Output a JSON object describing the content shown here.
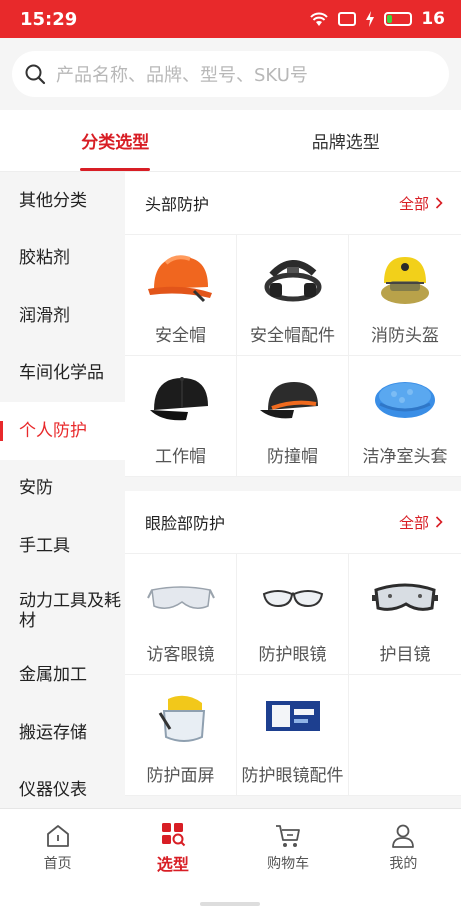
{
  "status": {
    "time": "15:29",
    "battery": "16",
    "battery_color": "#3ed640"
  },
  "search": {
    "placeholder": "产品名称、品牌、型号、SKU号"
  },
  "tabs": [
    {
      "label": "分类选型",
      "active": true
    },
    {
      "label": "品牌选型",
      "active": false
    }
  ],
  "sidebar": {
    "items": [
      {
        "label": "其他分类"
      },
      {
        "label": "胶粘剂"
      },
      {
        "label": "润滑剂"
      },
      {
        "label": "车间化学品"
      },
      {
        "label": "个人防护",
        "active": true
      },
      {
        "label": "安防"
      },
      {
        "label": "手工具"
      },
      {
        "label": "动力工具及耗材"
      },
      {
        "label": "金属加工"
      },
      {
        "label": "搬运存储"
      },
      {
        "label": "仪器仪表"
      }
    ]
  },
  "sections": [
    {
      "title": "头部防护",
      "all_label": "全部",
      "items": [
        {
          "label": "安全帽",
          "icon": "hard-hat-orange"
        },
        {
          "label": "安全帽配件",
          "icon": "hat-suspension"
        },
        {
          "label": "消防头盔",
          "icon": "fire-helmet"
        },
        {
          "label": "工作帽",
          "icon": "work-cap"
        },
        {
          "label": "防撞帽",
          "icon": "bump-cap"
        },
        {
          "label": "洁净室头套",
          "icon": "cleanroom-cap"
        }
      ]
    },
    {
      "title": "眼脸部防护",
      "all_label": "全部",
      "items": [
        {
          "label": "访客眼镜",
          "icon": "visitor-glasses"
        },
        {
          "label": "防护眼镜",
          "icon": "safety-glasses"
        },
        {
          "label": "护目镜",
          "icon": "goggles"
        },
        {
          "label": "防护面屏",
          "icon": "face-shield"
        },
        {
          "label": "防护眼镜配件",
          "icon": "glasses-accessory"
        }
      ]
    }
  ],
  "bottom_nav": [
    {
      "label": "首页",
      "icon": "home-icon"
    },
    {
      "label": "选型",
      "icon": "category-search-icon",
      "active": true
    },
    {
      "label": "购物车",
      "icon": "cart-icon"
    },
    {
      "label": "我的",
      "icon": "user-icon"
    }
  ],
  "colors": {
    "brand": "#e8292b",
    "accent": "#d81e25"
  }
}
